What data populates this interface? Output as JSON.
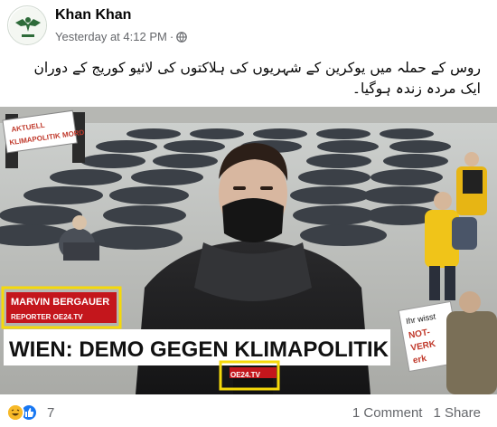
{
  "post": {
    "author": "Khan Khan",
    "timestamp": "Yesterday at 4:12 PM",
    "separator": "·",
    "privacy_icon": "globe-icon",
    "caption_line1": "روس کے حملہ میں یوکرین کے شہریوں کی ہلاکتوں کی لائیو کوریج کے دوران",
    "caption_line2": "ایک مردہ زندہ ہوگیا۔"
  },
  "media": {
    "banner_left_sign_line1": "AKTUELL",
    "banner_left_sign_line2": "KLIMAPOLITIK MORD",
    "reporter_name": "MARVIN BERGAUER",
    "reporter_role": "REPORTER OE24.TV",
    "headline": "WIEN: DEMO GEGEN KLIMAPOLITIK",
    "mic_logo": "OE24.TV",
    "right_sign_line1": "Ihr wisst",
    "right_sign_line2": "NOT-",
    "right_sign_line3": "VERK",
    "right_sign_line4": "erk"
  },
  "footer": {
    "reaction_count": "7",
    "comments": "1 Comment",
    "shares": "1 Share"
  },
  "colors": {
    "highlight_box": "#f5d90a",
    "secondary_text": "#65676b",
    "like_blue": "#1877f2"
  }
}
